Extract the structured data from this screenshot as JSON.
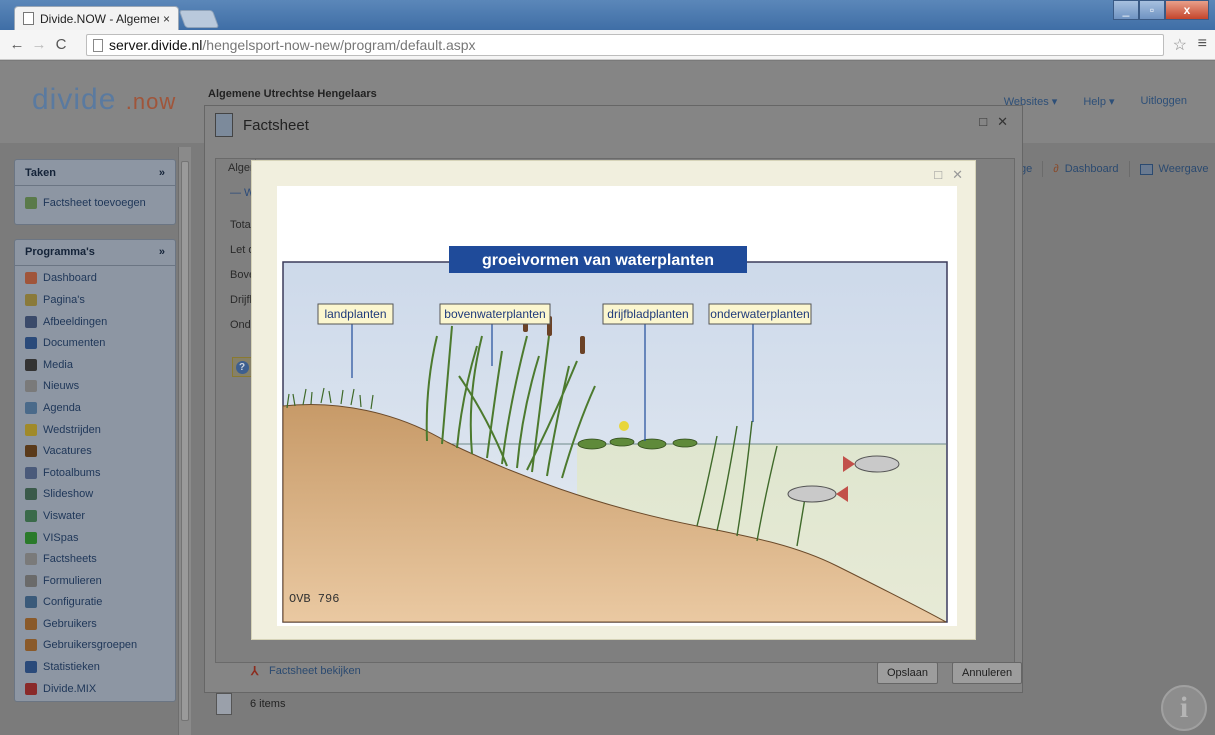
{
  "browser": {
    "tab_title": "Divide.NOW - Algemene",
    "tab_close": "×",
    "url_host": "server.divide.nl",
    "url_path": "/hengelsport-now-new/program/default.aspx",
    "star_icon": "☆",
    "menu_icon": "≡"
  },
  "header": {
    "logo_main": "divide",
    "logo_dot": ".",
    "logo_suffix": "now",
    "org_name": "Algemene Utrechtse Hengelaars",
    "nav": {
      "websites": "Websites ▾",
      "help": "Help ▾",
      "logout": "Uitloggen"
    }
  },
  "sidebar": {
    "tasks_title": "Taken",
    "tasks_items": [
      {
        "label": "Factsheet toevoegen"
      }
    ],
    "programs_title": "Programma's",
    "programs_items": [
      {
        "label": "Dashboard",
        "color": "#a0553a"
      },
      {
        "label": "Pagina's",
        "color": "#8a7a3a"
      },
      {
        "label": "Afbeeldingen",
        "color": "#3a4a6a"
      },
      {
        "label": "Documenten",
        "color": "#2a4a7a"
      },
      {
        "label": "Media",
        "color": "#333"
      },
      {
        "label": "Nieuws",
        "color": "#7a7a7a"
      },
      {
        "label": "Agenda",
        "color": "#4a6a8a"
      },
      {
        "label": "Wedstrijden",
        "color": "#a08a2a"
      },
      {
        "label": "Vacatures",
        "color": "#5a3a1a"
      },
      {
        "label": "Fotoalbums",
        "color": "#4a5a7a"
      },
      {
        "label": "Slideshow",
        "color": "#3a5a4a"
      },
      {
        "label": "Viswater",
        "color": "#3a6a4a"
      },
      {
        "label": "VISpas",
        "color": "#2a7a2a"
      },
      {
        "label": "Factsheets",
        "color": "#7a7a7a"
      },
      {
        "label": "Formulieren",
        "color": "#6a6a6a"
      },
      {
        "label": "Configuratie",
        "color": "#3a5a7a"
      },
      {
        "label": "Gebruikers",
        "color": "#8a5a2a"
      },
      {
        "label": "Gebruikersgroepen",
        "color": "#8a5a2a"
      },
      {
        "label": "Statistieken",
        "color": "#2a4a7a"
      },
      {
        "label": "Divide.MIX",
        "color": "#8a2a2a"
      }
    ]
  },
  "toolbar_right": {
    "truncated": "ge",
    "dashboard": "Dashboard",
    "weergave": "Weergave"
  },
  "bottom": {
    "items_count": "6 items"
  },
  "factsheet_dialog": {
    "title": "Factsheet",
    "tab_label": "Alger",
    "w_label": "— W",
    "field_labels": [
      "Tota",
      "Let o",
      "Bove",
      "Drijfl",
      "Ond"
    ],
    "view_link": "Factsheet bekijken",
    "save": "Opslaan",
    "cancel": "Annuleren",
    "maximize_icon": "□",
    "close_icon": "✕"
  },
  "lightbox": {
    "maximize_icon": "□",
    "close_icon": "✕",
    "image": {
      "title": "groeivormen van waterplanten",
      "labels": [
        "landplanten",
        "bovenwaterplanten",
        "drijfbladplanten",
        "onderwaterplanten"
      ],
      "signature": "OVB 796"
    }
  }
}
